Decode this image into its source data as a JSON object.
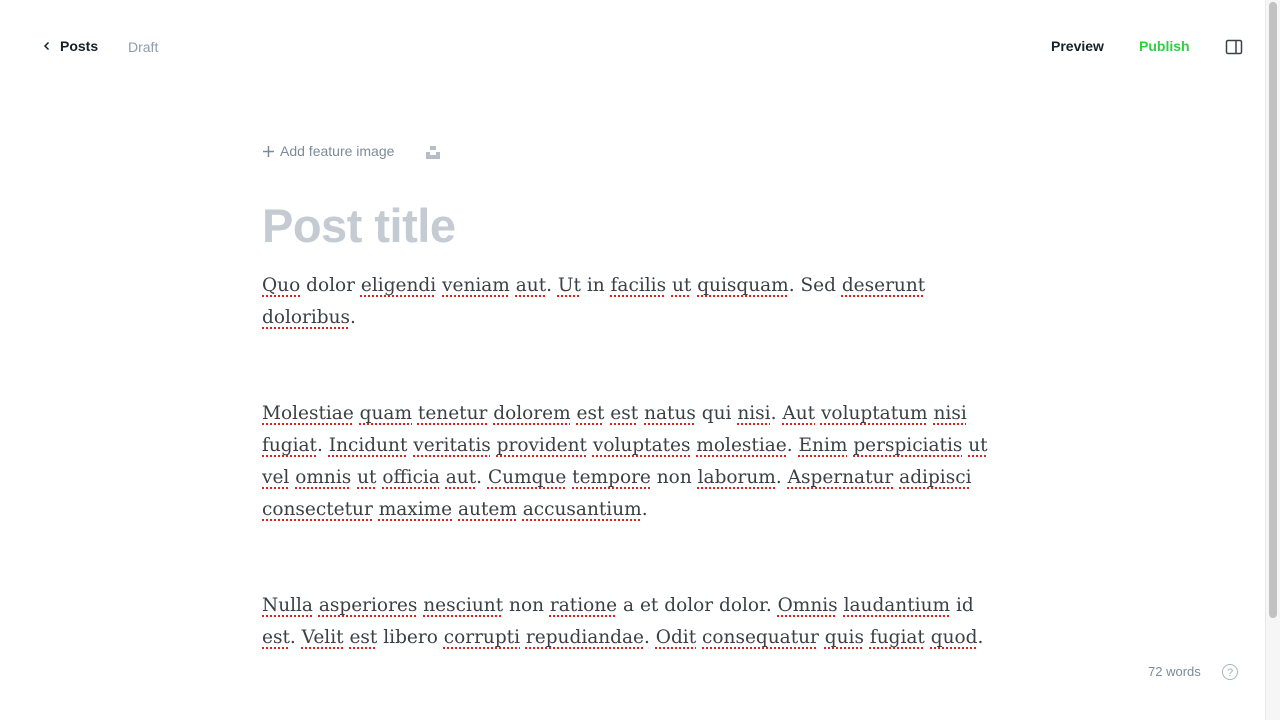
{
  "header": {
    "back_label": "Posts",
    "status": "Draft",
    "preview_label": "Preview",
    "publish_label": "Publish",
    "publish_color": "#30cf43"
  },
  "editor": {
    "feature_image_label": "Add feature image",
    "title_placeholder": "Post title",
    "paragraphs": [
      "Quo dolor eligendi veniam aut. Ut in facilis ut quisquam. Sed deserunt doloribus.",
      "",
      "",
      "Molestiae quam tenetur dolorem est est natus qui nisi. Aut voluptatum nisi fugiat. Incidunt veritatis provident voluptates molestiae. Enim perspiciatis ut vel omnis ut officia aut. Cumque tempore non laborum. Aspernatur adipisci consectetur maxime autem accusantium.",
      "",
      "",
      "Nulla asperiores nesciunt non ratione a et dolor dolor. Omnis laudantium id est. Velit est libero corrupti repudiandae. Odit consequatur quis fugiat quod."
    ],
    "spellcheck_flagged": [
      "Quo",
      "eligendi",
      "veniam",
      "aut",
      "Ut",
      "facilis",
      "ut",
      "quisquam",
      "deserunt",
      "doloribus",
      "Molestiae",
      "quam",
      "tenetur",
      "dolorem",
      "est",
      "natus",
      "nisi",
      "Aut",
      "voluptatum",
      "fugiat",
      "Incidunt",
      "veritatis",
      "provident",
      "voluptates",
      "molestiae",
      "Enim",
      "perspiciatis",
      "vel",
      "omnis",
      "officia",
      "Cumque",
      "tempore",
      "laborum",
      "Aspernatur",
      "adipisci",
      "consectetur",
      "maxime",
      "autem",
      "accusantium",
      "Nulla",
      "asperiores",
      "nesciunt",
      "ratione",
      "Omnis",
      "laudantium",
      "Velit",
      "corrupti",
      "repudiandae",
      "Odit",
      "consequatur",
      "quis",
      "quod"
    ]
  },
  "footer": {
    "word_count": "72 words",
    "help_label": "?"
  }
}
